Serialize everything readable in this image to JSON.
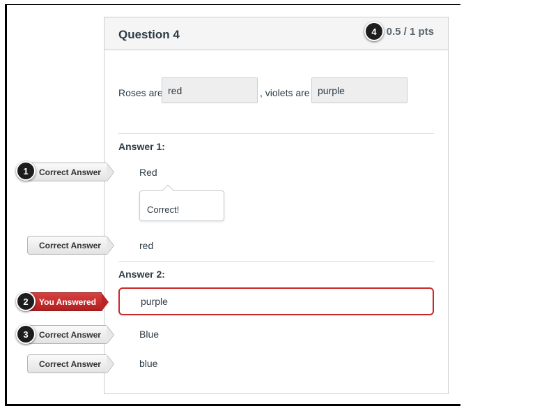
{
  "question": {
    "title": "Question 4",
    "points": "0.5 / 1 pts",
    "text_parts": [
      "Roses are",
      ", violets are"
    ],
    "blanks": [
      "red",
      "purple"
    ]
  },
  "answers": [
    {
      "heading": "Answer 1:",
      "rows": [
        {
          "tag": "Correct Answer",
          "value": "Red",
          "badge": "1"
        },
        {
          "tag": "Correct Answer",
          "value": "red"
        }
      ],
      "feedback": "Correct!"
    },
    {
      "heading": "Answer 2:",
      "rows": [
        {
          "tag": "You Answered",
          "value": "purple",
          "badge": "2"
        },
        {
          "tag": "Correct Answer",
          "value": "Blue",
          "badge": "3"
        },
        {
          "tag": "Correct Answer",
          "value": "blue"
        }
      ]
    }
  ],
  "points_badge": "4",
  "colors": {
    "wrong_accent": "#c92828",
    "badge_bg": "#1d1d1d",
    "header_bg": "#f5f5f5"
  }
}
